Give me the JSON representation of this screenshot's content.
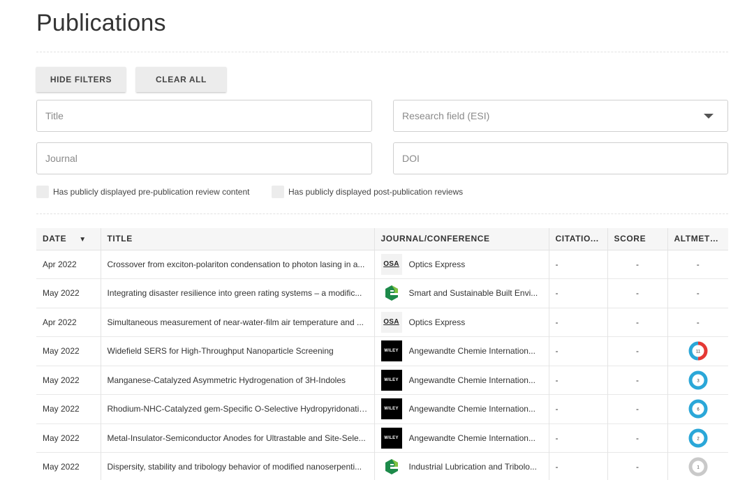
{
  "page": {
    "title": "Publications"
  },
  "filters": {
    "hide_filters_label": "HIDE FILTERS",
    "clear_all_label": "CLEAR ALL",
    "title_placeholder": "Title",
    "research_field_placeholder": "Research field (ESI)",
    "journal_placeholder": "Journal",
    "doi_placeholder": "DOI",
    "pre_review_label": "Has publicly displayed pre-publication review content",
    "post_review_label": "Has publicly displayed post-publication reviews"
  },
  "table": {
    "headers": {
      "date": "DATE",
      "title": "TITLE",
      "journal": "JOURNAL/CONFERENCE",
      "citations": "CITATIO...",
      "score": "SCORE",
      "altmetric": "ALTMETRIC"
    },
    "sort_icon": "sort-desc-icon",
    "rows": [
      {
        "date": "Apr 2022",
        "title": "Crossover from exciton-polariton condensation to photon lasing in a...",
        "journal": "Optics Express",
        "logo": "OSA",
        "citations": "-",
        "score": "-",
        "altmetric": "-"
      },
      {
        "date": "May 2022",
        "title": "Integrating disaster resilience into green rating systems – a modific...",
        "journal": "Smart and Sustainable Built Envi...",
        "logo": "emerald",
        "citations": "-",
        "score": "-",
        "altmetric": "-"
      },
      {
        "date": "Apr 2022",
        "title": "Simultaneous measurement of near-water-film air temperature and ...",
        "journal": "Optics Express",
        "logo": "OSA",
        "citations": "-",
        "score": "-",
        "altmetric": "-"
      },
      {
        "date": "May 2022",
        "title": "Widefield SERS for High-Throughput Nanoparticle Screening",
        "journal": "Angewandte Chemie Internation...",
        "logo": "WILEY",
        "citations": "-",
        "score": "-",
        "altmetric": "11",
        "altmetric_colors": [
          "#e53935",
          "#2ba7d8"
        ]
      },
      {
        "date": "May 2022",
        "title": "Manganese-Catalyzed Asymmetric Hydrogenation of 3H-Indoles",
        "journal": "Angewandte Chemie Internation...",
        "logo": "WILEY",
        "citations": "-",
        "score": "-",
        "altmetric": "3",
        "altmetric_colors": [
          "#2ba7d8"
        ]
      },
      {
        "date": "May 2022",
        "title": "Rhodium-NHC-Catalyzed gem-Specific O-Selective Hydropyridonatio...",
        "journal": "Angewandte Chemie Internation...",
        "logo": "WILEY",
        "citations": "-",
        "score": "-",
        "altmetric": "6",
        "altmetric_colors": [
          "#2ba7d8"
        ]
      },
      {
        "date": "May 2022",
        "title": "Metal-Insulator-Semiconductor Anodes for Ultrastable and Site-Sele...",
        "journal": "Angewandte Chemie Internation...",
        "logo": "WILEY",
        "citations": "-",
        "score": "-",
        "altmetric": "2",
        "altmetric_colors": [
          "#2ba7d8"
        ]
      },
      {
        "date": "May 2022",
        "title": "Dispersity, stability and tribology behavior of modified nanoserpenti...",
        "journal": "Industrial Lubrication and Tribolo...",
        "logo": "emerald",
        "citations": "-",
        "score": "-",
        "altmetric": "1",
        "altmetric_colors": [
          "#c9c9c9"
        ]
      }
    ]
  },
  "colors": {
    "emerald_dark": "#1d8a4a",
    "emerald_light": "#7fc241",
    "wiley_bg": "#000000"
  }
}
